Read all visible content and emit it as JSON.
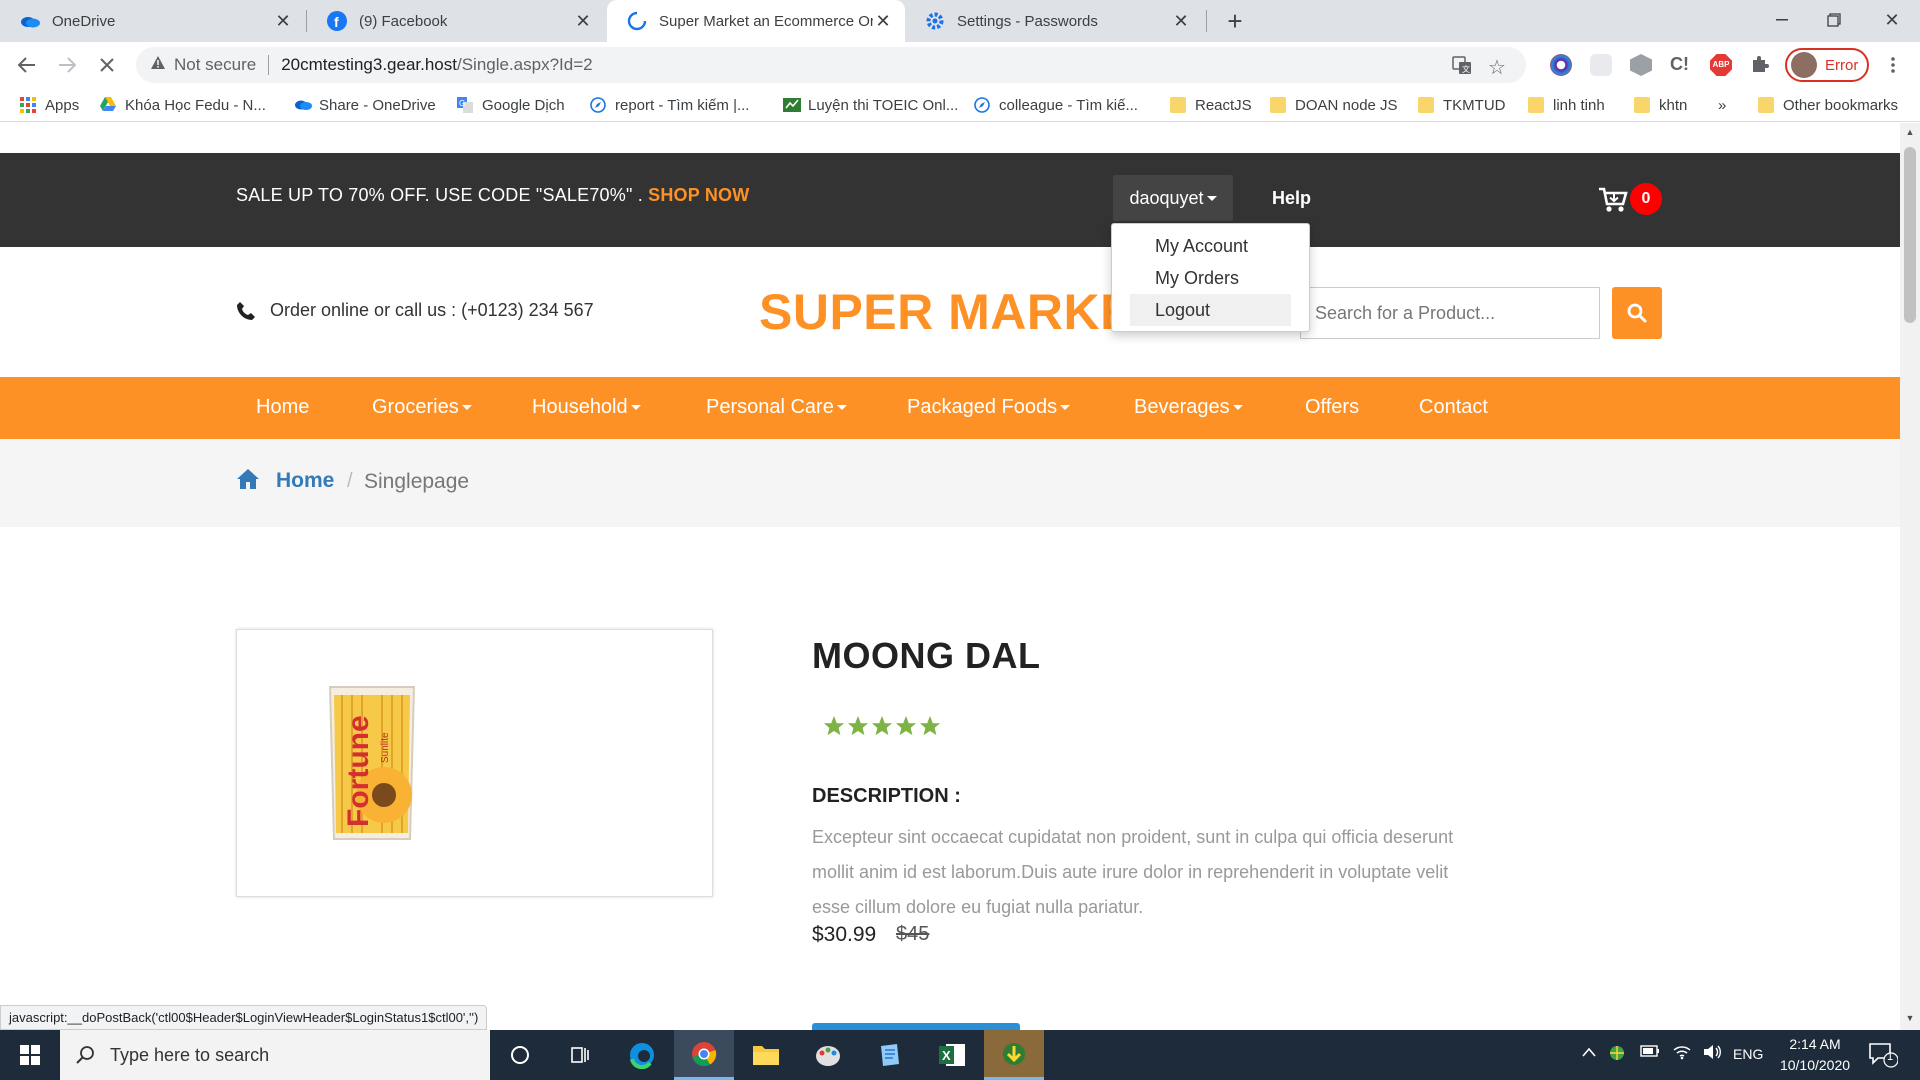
{
  "browser": {
    "tabs": [
      {
        "title": "OneDrive",
        "icon": "onedrive-icon"
      },
      {
        "title": "(9) Facebook",
        "icon": "facebook-icon"
      },
      {
        "title": "Super Market an Ecommerce Onl",
        "icon": "loading-icon"
      },
      {
        "title": "Settings - Passwords",
        "icon": "settings-gear-icon"
      }
    ],
    "security_label": "Not secure",
    "url_host": "20cmtesting3.gear.host",
    "url_path": "/Single.aspx?Id=2",
    "profile_label": "Error",
    "bookmarks": [
      "Apps",
      "Khóa Học Fedu - N...",
      "Share - OneDrive",
      "Google Dịch",
      "report - Tìm kiếm |...",
      "Luyện thi TOEIC Onl...",
      "colleague - Tìm kiế...",
      "ReactJS",
      "DOAN node JS",
      "TKMTUD",
      "linh tinh",
      "khtn",
      "»",
      "Other bookmarks"
    ],
    "status_url": "javascript:__doPostBack('ctl00$Header$LoginViewHeader$LoginStatus1$ctl00','')"
  },
  "site": {
    "promo_text": "SALE UP TO 70% OFF. USE CODE \"SALE70%\" . ",
    "promo_link": "SHOP NOW",
    "username": "daoquyet",
    "help": "Help",
    "cart_count": "0",
    "call_text": "Order online or call us : (+0123) 234 567",
    "logo": "SUPER MARKET",
    "search_placeholder": "Search for a Product...",
    "user_menu": [
      "My Account",
      "My Orders",
      "Logout"
    ],
    "nav": [
      {
        "label": "Home",
        "dropdown": false
      },
      {
        "label": "Groceries",
        "dropdown": true
      },
      {
        "label": "Household",
        "dropdown": true
      },
      {
        "label": "Personal Care",
        "dropdown": true
      },
      {
        "label": "Packaged Foods",
        "dropdown": true
      },
      {
        "label": "Beverages",
        "dropdown": true
      },
      {
        "label": "Offers",
        "dropdown": false
      },
      {
        "label": "Contact",
        "dropdown": false
      }
    ],
    "breadcrumb": {
      "home": "Home",
      "separator": "/",
      "current": "Singlepage"
    }
  },
  "product": {
    "title": "MOONG DAL",
    "rating": 5,
    "description_label": "DESCRIPTION :",
    "description": "Excepteur sint occaecat cupidatat non proident, sunt in culpa qui officia deserunt mollit anim id est laborum.Duis aute irure dolor in reprehenderit in voluptate velit esse cillum dolore eu fugiat nulla pariatur.",
    "price": "$30.99",
    "old_price": "$45",
    "image_brand": "Fortune",
    "image_subbrand": "Sunlite"
  },
  "taskbar": {
    "search_placeholder": "Type here to search",
    "language": "ENG",
    "time": "2:14 AM",
    "date": "10/10/2020",
    "notification_count": "1"
  },
  "colors": {
    "accent_orange": "#fe9126",
    "topbar_dark": "#333333",
    "link_blue": "#337ab7",
    "rating_green": "#7cb342",
    "badge_red": "#ff0000"
  }
}
